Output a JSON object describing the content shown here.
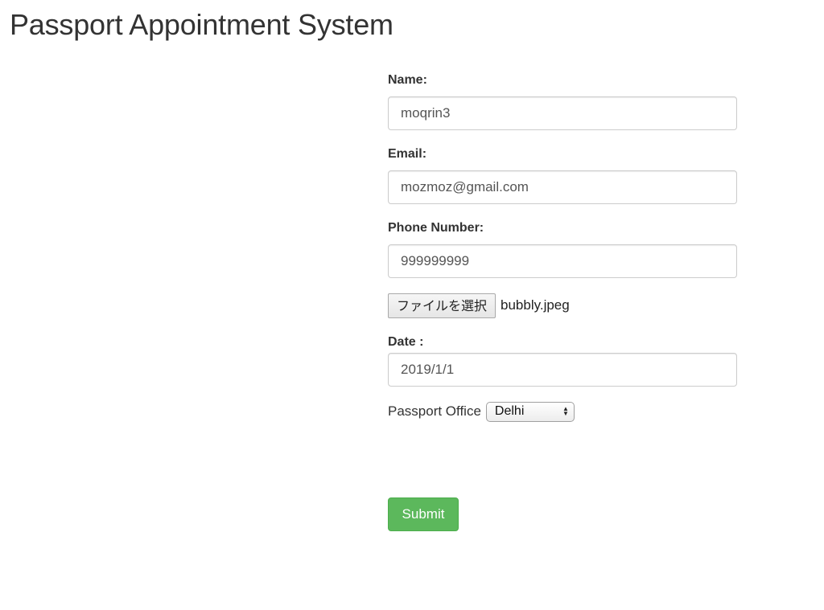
{
  "page": {
    "title": "Passport Appointment System"
  },
  "form": {
    "name": {
      "label": "Name:",
      "value": "moqrin3"
    },
    "email": {
      "label": "Email:",
      "value": "mozmoz@gmail.com"
    },
    "phone": {
      "label": "Phone Number:",
      "value": "999999999"
    },
    "file": {
      "button_label": "ファイルを選択",
      "file_name": "bubbly.jpeg"
    },
    "date": {
      "label": "Date :",
      "value": "2019/1/1"
    },
    "office": {
      "label": "Passport Office",
      "selected": "Delhi"
    },
    "submit_label": "Submit"
  },
  "icons": {
    "select_arrows": "up-down-arrows-icon"
  },
  "colors": {
    "submit_bg": "#5cb85c",
    "text": "#333333",
    "input_border": "#cccccc"
  }
}
